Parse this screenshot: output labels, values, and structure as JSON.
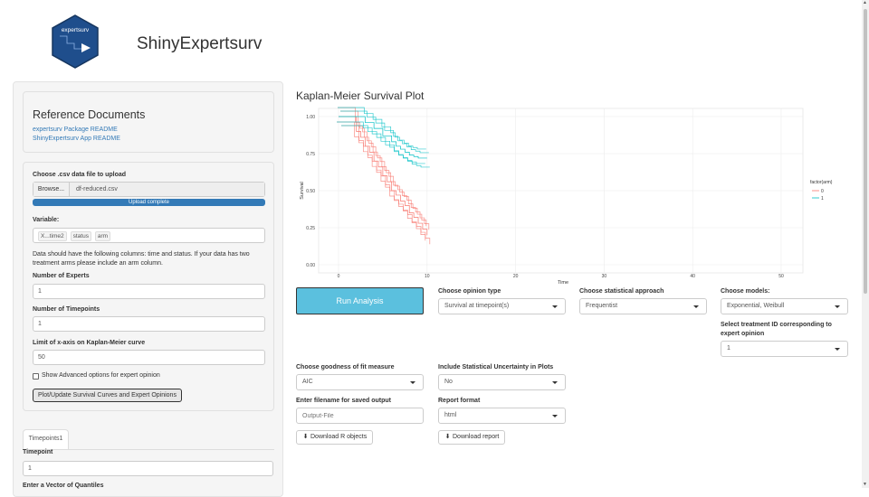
{
  "header": {
    "logo_text": "expertsurv",
    "title": "ShinyExpertsurv"
  },
  "sidebar": {
    "reference": {
      "title": "Reference Documents",
      "links": [
        "expertsurv Package README",
        "ShinyExpertsurv App README"
      ]
    },
    "upload": {
      "label": "Choose .csv data file to upload",
      "browse_label": "Browse...",
      "file_name": "df-reduced.csv",
      "progress_text": "Upload complete",
      "progress": 1.0
    },
    "variable": {
      "label": "Variable:",
      "chips": [
        "X...time2",
        "status",
        "arm"
      ]
    },
    "note": "Data should have the following columns: time and status. If your data has two treatment arms please include an arm column.",
    "num_experts": {
      "label": "Number of Experts",
      "value": "1"
    },
    "num_timepoints": {
      "label": "Number of Timepoints",
      "value": "1"
    },
    "xlimit": {
      "label": "Limit of x-axis on Kaplan-Meier curve",
      "value": "50"
    },
    "advanced_label": "Show Advanced options for expert opinion",
    "advanced_checked": false,
    "plot_button": "Plot/Update Survival Curves and Expert Opinions",
    "tab_label": "Timepoints1",
    "timepoint": {
      "label": "Timepoint",
      "value": "1"
    },
    "quantiles_label": "Enter a Vector of Quantiles"
  },
  "main": {
    "km_title": "Kaplan-Meier Survival Plot",
    "run_button": "Run Analysis",
    "opinion_type": {
      "label": "Choose opinion type",
      "value": "Survival at timepoint(s)"
    },
    "stat_approach": {
      "label": "Choose statistical approach",
      "value": "Frequentist"
    },
    "models": {
      "label": "Choose models:",
      "value": "Exponential, Weibull"
    },
    "treatment_id": {
      "label": "Select treatment ID corresponding to expert opinion",
      "value": "1"
    },
    "gof": {
      "label": "Choose goodness of fit measure",
      "value": "AIC"
    },
    "uncertainty": {
      "label": "Include Statistical Uncertainty in Plots",
      "value": "No"
    },
    "filename": {
      "label": "Enter filename for saved output",
      "placeholder": "Output-File"
    },
    "report_format": {
      "label": "Report format",
      "value": "html"
    },
    "download_r": "Download R objects",
    "download_report": "Download report"
  },
  "colors": {
    "series_0": "#f8766d",
    "series_1": "#00bfc4",
    "run_button": "#5bc0de",
    "link": "#337ab7",
    "logo_fill": "#1f4e8c"
  },
  "chart_data": {
    "type": "line",
    "xlabel": "Time",
    "ylabel": "Survival",
    "xlim": [
      0,
      50
    ],
    "ylim": [
      0,
      1
    ],
    "x_ticks": [
      "0",
      "10",
      "20",
      "30",
      "40",
      "50"
    ],
    "y_ticks": [
      "0.00",
      "0.25",
      "0.50",
      "0.75",
      "1.00"
    ],
    "grid": true,
    "legend_title": "factor(arm)",
    "legend_position": "right",
    "series": [
      {
        "name": "0",
        "color": "#f8766d",
        "x": [
          0,
          2,
          2.5,
          3,
          3.5,
          4,
          4.5,
          5,
          5.5,
          6,
          6.5,
          7,
          7.5,
          8,
          8.5,
          9,
          9.5,
          10
        ],
        "y": [
          1,
          0.9,
          0.86,
          0.8,
          0.76,
          0.7,
          0.66,
          0.6,
          0.56,
          0.5,
          0.47,
          0.43,
          0.4,
          0.35,
          0.32,
          0.28,
          0.24,
          0.2
        ]
      },
      {
        "name": "1",
        "color": "#00bfc4",
        "x": [
          0,
          3,
          4,
          5,
          6,
          6.5,
          7,
          7.5,
          8,
          8.5,
          9,
          9.5,
          10
        ],
        "y": [
          1,
          0.96,
          0.92,
          0.87,
          0.83,
          0.8,
          0.78,
          0.76,
          0.74,
          0.73,
          0.72,
          0.72,
          0.72
        ]
      }
    ]
  }
}
